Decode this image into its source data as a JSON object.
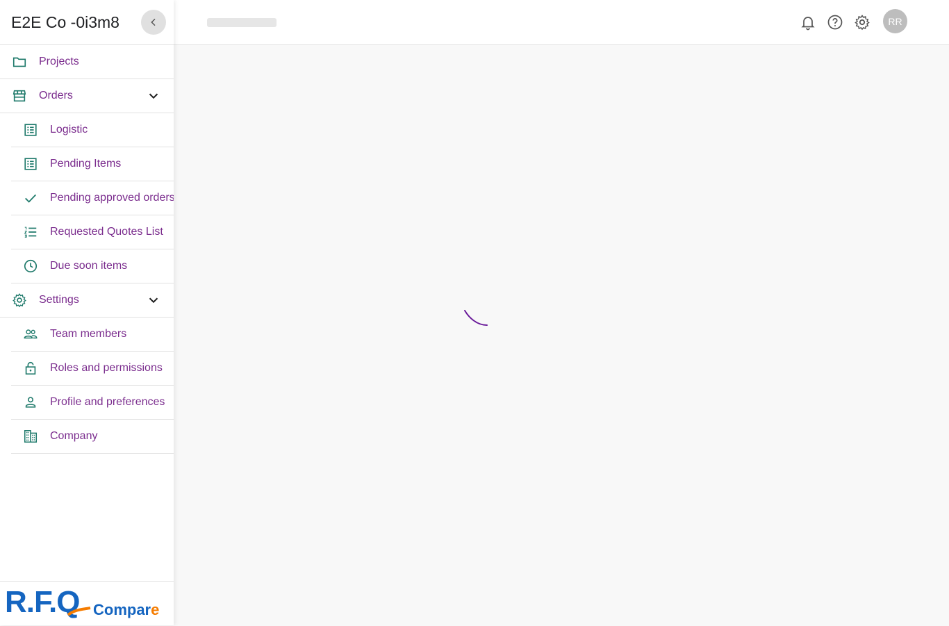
{
  "app": {
    "company_name": "E2E Co -0i3m8"
  },
  "sidebar": {
    "items": [
      {
        "label": "Projects",
        "icon": "folder-icon"
      },
      {
        "label": "Orders",
        "icon": "store-icon",
        "expanded": true
      },
      {
        "label": "Logistic",
        "icon": "list-alt-icon"
      },
      {
        "label": "Pending Items",
        "icon": "list-alt-icon"
      },
      {
        "label": "Pending approved orders",
        "icon": "check-icon"
      },
      {
        "label": "Requested Quotes List",
        "icon": "format-list-numbered-icon"
      },
      {
        "label": "Due soon items",
        "icon": "clock-icon"
      },
      {
        "label": "Settings",
        "icon": "gear-icon",
        "expanded": true
      },
      {
        "label": "Team members",
        "icon": "people-icon"
      },
      {
        "label": "Roles and permissions",
        "icon": "lock-icon"
      },
      {
        "label": "Profile and preferences",
        "icon": "person-icon"
      },
      {
        "label": "Company",
        "icon": "building-icon"
      }
    ]
  },
  "logo": {
    "rfq": "R.F.Q",
    "compare_main": "Compar",
    "compare_last": "e"
  },
  "header": {
    "icons": [
      "bell-icon",
      "help-icon",
      "gear-icon"
    ],
    "avatar_initials": "RR"
  },
  "colors": {
    "nav_text": "#7b2d8e",
    "nav_icon": "#1f7a6b",
    "logo_blue": "#1565c0",
    "logo_orange": "#f57c00",
    "spinner": "#6a1b9a"
  },
  "main": {
    "loading": true
  }
}
